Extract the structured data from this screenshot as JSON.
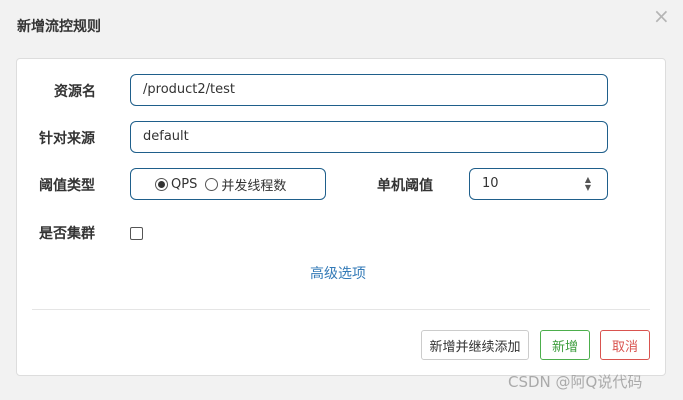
{
  "dialog": {
    "title": "新增流控规则",
    "close_symbol": "×"
  },
  "form": {
    "resource_label": "资源名",
    "resource_value": "/product2/test",
    "source_label": "针对来源",
    "source_value": "default",
    "threshold_type_label": "阈值类型",
    "threshold_type_options": [
      "QPS",
      "并发线程数"
    ],
    "threshold_type_selected": "QPS",
    "single_threshold_label": "单机阈值",
    "single_threshold_value": "10",
    "cluster_label": "是否集群",
    "cluster_checked": false,
    "advanced_link": "高级选项"
  },
  "buttons": {
    "add_continue": "新增并继续添加",
    "add": "新增",
    "cancel": "取消"
  },
  "watermark": "CSDN @阿Q说代码",
  "colors": {
    "input_border": "#1f5f8b",
    "link": "#337ab7",
    "success": "#3c9c3c",
    "danger": "#d9534f"
  }
}
